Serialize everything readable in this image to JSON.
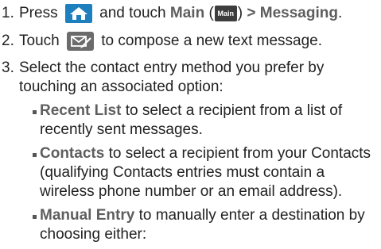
{
  "steps": [
    {
      "number": "1.",
      "pre": "Press",
      "mid": "and touch",
      "bold": "Main",
      "paren_open": "(",
      "main_icon": "Main",
      "paren_close": ")",
      "gt": ">",
      "bold2": "Messaging",
      "end": "."
    },
    {
      "number": "2.",
      "pre": "Touch",
      "post": "to compose a new text message."
    },
    {
      "number": "3.",
      "line1": "Select the contact entry method you prefer by",
      "line2": "touching an associated option:"
    }
  ],
  "bullets": [
    {
      "bold": "Recent List",
      "line1": "to select a recipient from a list of",
      "line2": "recently sent messages."
    },
    {
      "bold": "Contacts",
      "line1": "to select a recipient from your Contacts",
      "line2": "(qualifying Contacts entries must contain a",
      "line3": "wireless phone number or an email address)."
    },
    {
      "bold": "Manual Entry",
      "line1": "to manually enter a destination by",
      "line2": "choosing either:"
    }
  ],
  "icons": {
    "home": "home-icon",
    "main": "main-apps-icon",
    "compose": "compose-message-icon"
  },
  "colors": {
    "home_icon": "#1e7fbf",
    "compose_icon": "#6b6b6b",
    "bold_text": "#5e5e5e"
  }
}
